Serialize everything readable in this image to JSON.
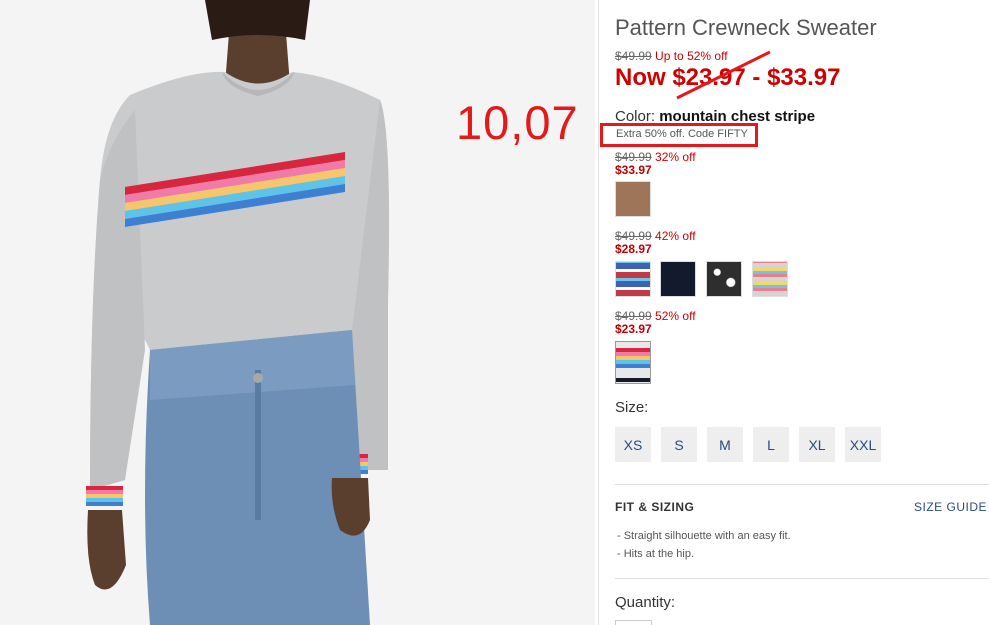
{
  "product": {
    "title": "Pattern Crewneck Sweater",
    "original_price": "$49.99",
    "discount_text": "Up to 52% off",
    "now_price": "Now $23.97 - $33.97",
    "color_label": "Color:",
    "color_name": "mountain chest stripe",
    "promo": "Extra 50% off. Code FIFTY"
  },
  "annotation": {
    "number": "10,07"
  },
  "price_groups": [
    {
      "was": "$49.99",
      "off": "32% off",
      "now": "$33.97"
    },
    {
      "was": "$49.99",
      "off": "42% off",
      "now": "$28.97"
    },
    {
      "was": "$49.99",
      "off": "52% off",
      "now": "$23.97"
    }
  ],
  "swatches": {
    "camel": "#9e7558",
    "navy": "#141a2e",
    "fairisle_red_blue": "#c23a4a",
    "black_white": "#333333",
    "grey_stripe": "#d4d4d4",
    "rainbow_stripe": "#e8e8e8"
  },
  "size": {
    "label": "Size:",
    "options": [
      "XS",
      "S",
      "M",
      "L",
      "XL",
      "XXL"
    ]
  },
  "fit": {
    "title": "FIT & SIZING",
    "guide_link": "SIZE GUIDE",
    "items": [
      "- Straight silhouette with an easy fit.",
      "- Hits at the hip."
    ]
  },
  "quantity": {
    "label": "Quantity:"
  },
  "colors": {
    "sale_red": "#d00000",
    "annotation_red": "#e41a1a",
    "link_blue": "#2a4b7c"
  }
}
